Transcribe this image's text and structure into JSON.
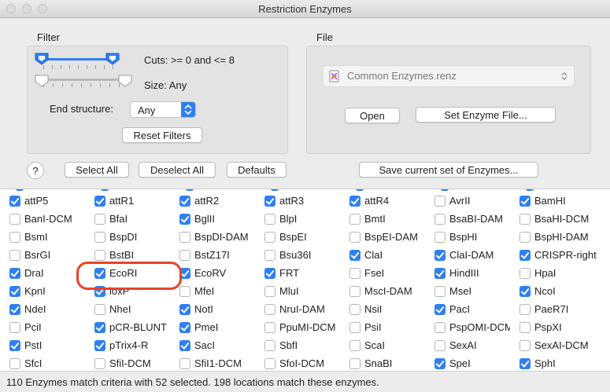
{
  "window": {
    "title": "Restriction Enzymes"
  },
  "filter": {
    "group_label": "Filter",
    "cuts_label": "Cuts: >= 0 and <= 8",
    "size_label": "Size: Any",
    "end_structure_label": "End structure:",
    "end_structure_value": "Any",
    "reset_button": "Reset Filters"
  },
  "file": {
    "group_label": "File",
    "selected_file": "Common Enzymes.renz",
    "open_button": "Open",
    "set_file_button": "Set Enzyme File..."
  },
  "toolbar": {
    "help_label": "?",
    "select_all": "Select All",
    "deselect_all": "Deselect All",
    "defaults": "Defaults",
    "save_set": "Save current set of Enzymes..."
  },
  "enzymes": [
    [
      {
        "name": "attP5",
        "checked": true
      },
      {
        "name": "attR1",
        "checked": true
      },
      {
        "name": "attR2",
        "checked": true
      },
      {
        "name": "attR3",
        "checked": true
      },
      {
        "name": "attR4",
        "checked": true
      },
      {
        "name": "AvrII",
        "checked": false
      },
      {
        "name": "BamHI",
        "checked": true
      }
    ],
    [
      {
        "name": "BanI-DCM",
        "checked": false
      },
      {
        "name": "BfaI",
        "checked": false
      },
      {
        "name": "BglII",
        "checked": true
      },
      {
        "name": "BlpI",
        "checked": false
      },
      {
        "name": "BmtI",
        "checked": false
      },
      {
        "name": "BsaBI-DAM",
        "checked": false
      },
      {
        "name": "BsaHI-DCM",
        "checked": false
      }
    ],
    [
      {
        "name": "BsmI",
        "checked": false
      },
      {
        "name": "BspDI",
        "checked": false
      },
      {
        "name": "BspDI-DAM",
        "checked": false
      },
      {
        "name": "BspEI",
        "checked": false
      },
      {
        "name": "BspEI-DAM",
        "checked": false
      },
      {
        "name": "BspHI",
        "checked": false
      },
      {
        "name": "BspHI-DAM",
        "checked": false
      }
    ],
    [
      {
        "name": "BsrGI",
        "checked": false
      },
      {
        "name": "BstBI",
        "checked": false
      },
      {
        "name": "BstZ17I",
        "checked": false
      },
      {
        "name": "Bsu36I",
        "checked": false
      },
      {
        "name": "ClaI",
        "checked": true
      },
      {
        "name": "ClaI-DAM",
        "checked": true
      },
      {
        "name": "CRISPR-right",
        "checked": true
      }
    ],
    [
      {
        "name": "DraI",
        "checked": true
      },
      {
        "name": "EcoRI",
        "checked": true
      },
      {
        "name": "EcoRV",
        "checked": true
      },
      {
        "name": "FRT",
        "checked": true
      },
      {
        "name": "FseI",
        "checked": false
      },
      {
        "name": "HindIII",
        "checked": true
      },
      {
        "name": "HpaI",
        "checked": false
      }
    ],
    [
      {
        "name": "KpnI",
        "checked": true
      },
      {
        "name": "loxP",
        "checked": true
      },
      {
        "name": "MfeI",
        "checked": false
      },
      {
        "name": "MluI",
        "checked": false
      },
      {
        "name": "MscI-DAM",
        "checked": false
      },
      {
        "name": "MseI",
        "checked": false
      },
      {
        "name": "NcoI",
        "checked": true
      }
    ],
    [
      {
        "name": "NdeI",
        "checked": true
      },
      {
        "name": "NheI",
        "checked": false
      },
      {
        "name": "NotI",
        "checked": true
      },
      {
        "name": "NruI-DAM",
        "checked": false
      },
      {
        "name": "NsiI",
        "checked": false
      },
      {
        "name": "PacI",
        "checked": true
      },
      {
        "name": "PaeR7I",
        "checked": false
      }
    ],
    [
      {
        "name": "PciI",
        "checked": false
      },
      {
        "name": "pCR-BLUNT",
        "checked": true
      },
      {
        "name": "PmeI",
        "checked": true
      },
      {
        "name": "PpuMI-DCM",
        "checked": false
      },
      {
        "name": "PsiI",
        "checked": false
      },
      {
        "name": "PspOMI-DCM",
        "checked": false
      },
      {
        "name": "PspXI",
        "checked": false
      }
    ],
    [
      {
        "name": "PstI",
        "checked": true
      },
      {
        "name": "pTrix4-R",
        "checked": true
      },
      {
        "name": "SacI",
        "checked": true
      },
      {
        "name": "SbfI",
        "checked": false
      },
      {
        "name": "ScaI",
        "checked": false
      },
      {
        "name": "SexAI",
        "checked": false
      },
      {
        "name": "SexAI-DCM",
        "checked": false
      }
    ],
    [
      {
        "name": "SfcI",
        "checked": false
      },
      {
        "name": "SfiI-DCM",
        "checked": false
      },
      {
        "name": "SfiI1-DCM",
        "checked": false
      },
      {
        "name": "SfoI-DCM",
        "checked": false
      },
      {
        "name": "SnaBI",
        "checked": false
      },
      {
        "name": "SpeI",
        "checked": true
      },
      {
        "name": "SphI",
        "checked": true
      }
    ]
  ],
  "status": "110 Enzymes match criteria with 52 selected. 198 locations match these enzymes."
}
